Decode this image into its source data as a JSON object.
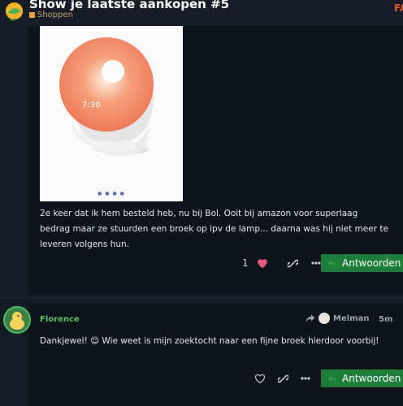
{
  "topic": {
    "title": "Show je laatste aankopen #5",
    "category": "Shoppen",
    "header_right": "FA"
  },
  "post1": {
    "text": "2e keer dat ik hem besteld heb, nu bij Bol. Ooit bij amazon voor superlaag bedrag maar ze stuurden een broek op ipv de lamp... daarna was hij niet meer te leveren volgens hun.",
    "image_clock": "7:30",
    "like_count": "1",
    "reply_label": "Antwoorden"
  },
  "post2": {
    "username": "Florence",
    "reply_to_user": "Melman",
    "time": "5m",
    "text": "Dankjewel! 😊 Wie weet is mijn zoektocht naar een fijne broek hierdoor voorbij!",
    "reply_label": "Antwoorden"
  },
  "colors": {
    "accent_green": "#1e7d3a",
    "like_heart": "#e45a7c",
    "category": "#e9a23b"
  }
}
